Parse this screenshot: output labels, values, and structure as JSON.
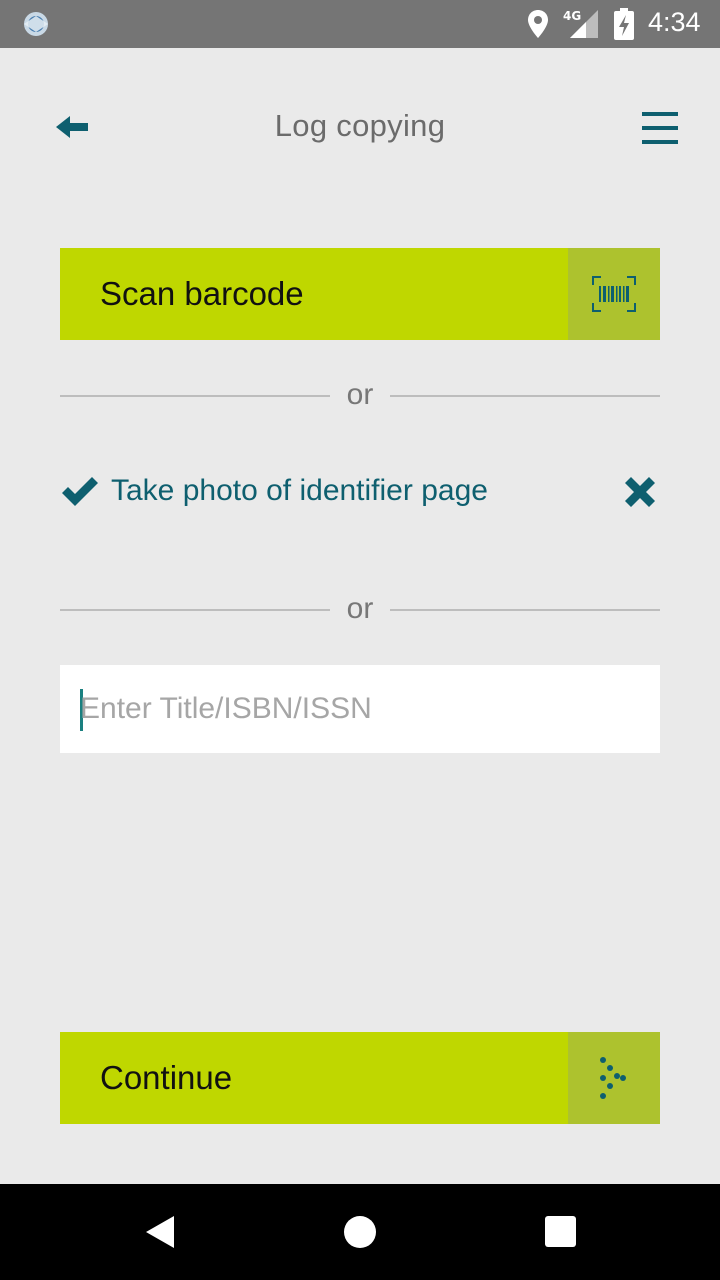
{
  "status_bar": {
    "network": "4G",
    "time": "4:34",
    "icons": [
      "app-logo-icon",
      "location-icon",
      "signal-icon",
      "battery-charging-icon"
    ]
  },
  "header": {
    "title": "Log copying",
    "back_icon": "arrow-left-icon",
    "menu_icon": "hamburger-menu-icon"
  },
  "scan_button": {
    "label": "Scan barcode",
    "icon": "barcode-scan-icon"
  },
  "divider_text": "or",
  "photo_option": {
    "label": "Take photo of identifier page",
    "checked": true,
    "check_icon": "checkmark-icon",
    "remove_icon": "close-x-icon"
  },
  "title_input": {
    "placeholder": "Enter Title/ISBN/ISSN",
    "value": ""
  },
  "continue_button": {
    "label": "Continue",
    "icon": "dotted-arrow-right-icon"
  },
  "colors": {
    "accent_green": "#bfd700",
    "icon_box_green": "#adc22e",
    "teal": "#0e5f6f",
    "background": "#eaeaea"
  }
}
